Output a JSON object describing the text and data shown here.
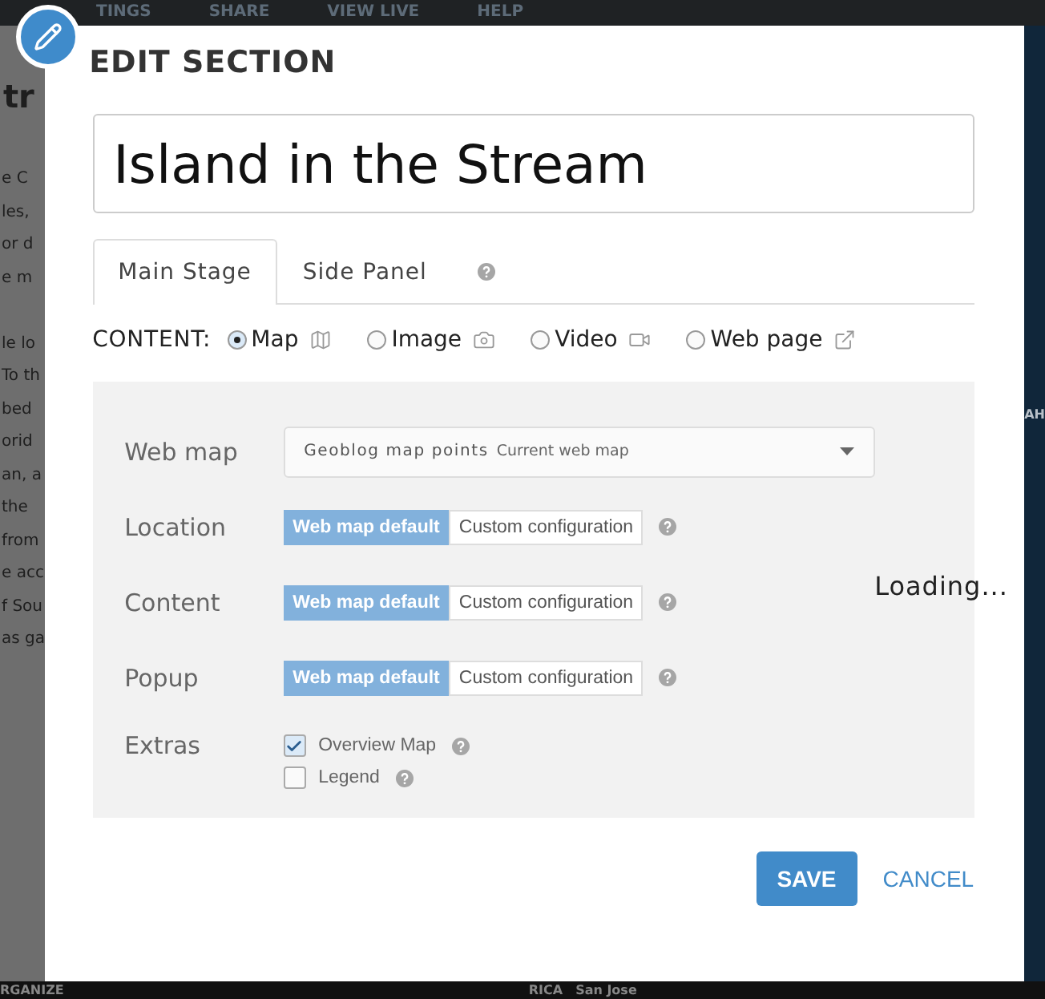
{
  "background": {
    "nav": [
      "TINGS",
      "SHARE",
      "VIEW LIVE",
      "HELP"
    ],
    "article_heading": "tr",
    "article_paragraphs": [
      [
        "e C",
        "les,",
        "or d",
        "e m"
      ],
      [
        "le lo",
        "To th",
        "bed",
        "orid",
        "an, a",
        "the",
        "from",
        "e acc",
        "f Sou",
        "as ga"
      ]
    ],
    "map_label": "AH",
    "footer_label": "RGANIZE",
    "map_bottom_labels": [
      "RICA",
      "San Jose"
    ]
  },
  "dialog": {
    "title": "EDIT SECTION",
    "section_title": "Island in the Stream",
    "tabs": [
      {
        "label": "Main Stage",
        "selected": true
      },
      {
        "label": "Side Panel",
        "selected": false
      }
    ],
    "content_label": "CONTENT:",
    "content_types": [
      {
        "label": "Map",
        "selected": true,
        "kind": "map"
      },
      {
        "label": "Image",
        "selected": false,
        "kind": "image"
      },
      {
        "label": "Video",
        "selected": false,
        "kind": "video"
      },
      {
        "label": "Web page",
        "selected": false,
        "kind": "webpage"
      }
    ],
    "web_map": {
      "label": "Web map",
      "value": "Geoblog map points",
      "note": "Current web map"
    },
    "settings": [
      {
        "label": "Location",
        "options": [
          {
            "label": "Web map default",
            "selected": true
          },
          {
            "label": "Custom configuration",
            "selected": false
          }
        ]
      },
      {
        "label": "Content",
        "options": [
          {
            "label": "Web map default",
            "selected": true
          },
          {
            "label": "Custom configuration",
            "selected": false
          }
        ]
      },
      {
        "label": "Popup",
        "options": [
          {
            "label": "Web map default",
            "selected": true
          },
          {
            "label": "Custom configuration",
            "selected": false
          }
        ]
      }
    ],
    "extras": {
      "label": "Extras",
      "items": [
        {
          "label": "Overview Map",
          "checked": true
        },
        {
          "label": "Legend",
          "checked": false
        }
      ]
    },
    "loading": "Loading...",
    "buttons": {
      "save": "SAVE",
      "cancel": "CANCEL"
    }
  }
}
